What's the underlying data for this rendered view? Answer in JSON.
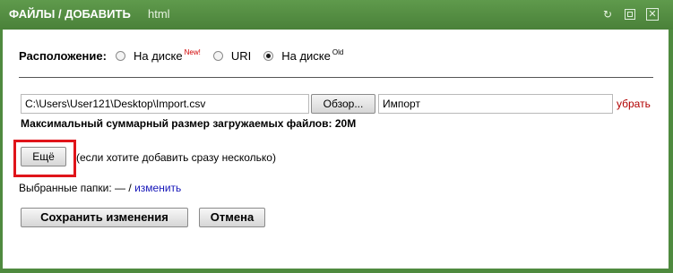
{
  "window": {
    "title": "ФАЙЛЫ / ДОБАВИТЬ",
    "subtitle": "html",
    "controls": {
      "refresh_icon": "refresh-icon",
      "restore_icon": "restore-icon",
      "close_icon": "close-icon"
    }
  },
  "location": {
    "label": "Расположение:",
    "options": [
      {
        "label": "На диске",
        "badge": "New!",
        "checked": false
      },
      {
        "label": "URI",
        "badge": "",
        "checked": false
      },
      {
        "label": "На диске",
        "badge": "Old",
        "checked": true
      }
    ]
  },
  "file": {
    "path_value": "C:\\Users\\User121\\Desktop\\Import.csv",
    "browse_label": "Обзор...",
    "name_value": "Импорт",
    "remove_label": "убрать",
    "max_size_text": "Максимальный суммарный размер загружаемых файлов: 20M"
  },
  "more": {
    "button_label": "Ещё",
    "hint": "(если хотите добавить сразу несколько)"
  },
  "folders": {
    "label": "Выбранные папки:",
    "value": "—",
    "separator": "/",
    "change_label": "изменить"
  },
  "actions": {
    "save_label": "Сохранить изменения",
    "cancel_label": "Отмена"
  },
  "colors": {
    "titlebar": "#4f8a3f",
    "highlight": "#e0141a",
    "link": "#1515b8",
    "remove_link": "#b10000"
  }
}
